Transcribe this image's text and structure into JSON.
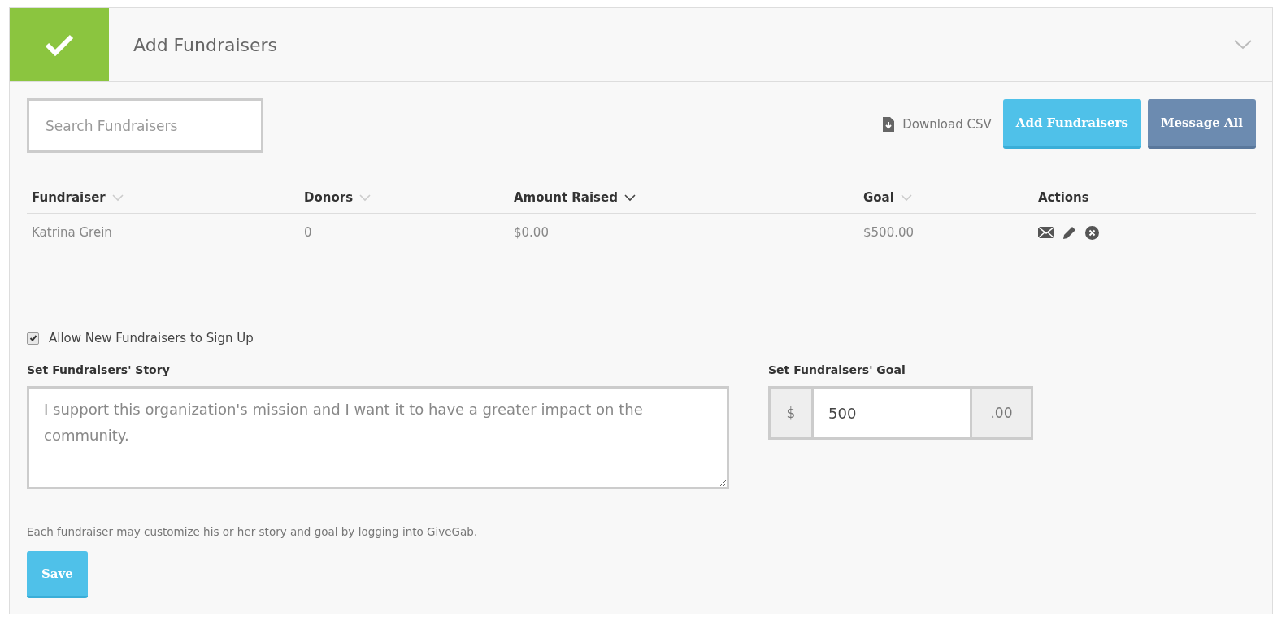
{
  "panel": {
    "title": "Add Fundraisers",
    "completed": true,
    "expanded": true
  },
  "search": {
    "placeholder": "Search Fundraisers"
  },
  "toolbar": {
    "download": "Download CSV",
    "buttons": [
      {
        "label": "Add Fundraisers",
        "kind": "primary"
      },
      {
        "label": "Message All",
        "kind": "secondary"
      }
    ]
  },
  "table": {
    "columns": [
      {
        "label": "Fundraiser",
        "sortable": true,
        "selected": false
      },
      {
        "label": "Donors",
        "sortable": true,
        "selected": false
      },
      {
        "label": "Amount Raised",
        "sortable": true,
        "selected": true
      },
      {
        "label": "Goal",
        "sortable": true,
        "selected": false
      },
      {
        "label": "Actions",
        "sortable": false
      }
    ],
    "rows": [
      {
        "cells": [
          "Katrina Grein",
          "0",
          "$0.00",
          "$500.00"
        ]
      }
    ]
  },
  "allow_signup": {
    "label": "Allow New Fundraisers to Sign Up",
    "checked": true
  },
  "story": {
    "label": "Set Fundraisers' Story",
    "placeholder": "I support this organization's mission and I want it to have a greater impact on the community."
  },
  "goal": {
    "label": "Set Fundraisers' Goal",
    "prefix": "$",
    "value": "500",
    "suffix": ".00"
  },
  "note": "Each fundraiser may customize his or her story and goal by logging into GiveGab.",
  "save": "Save"
}
